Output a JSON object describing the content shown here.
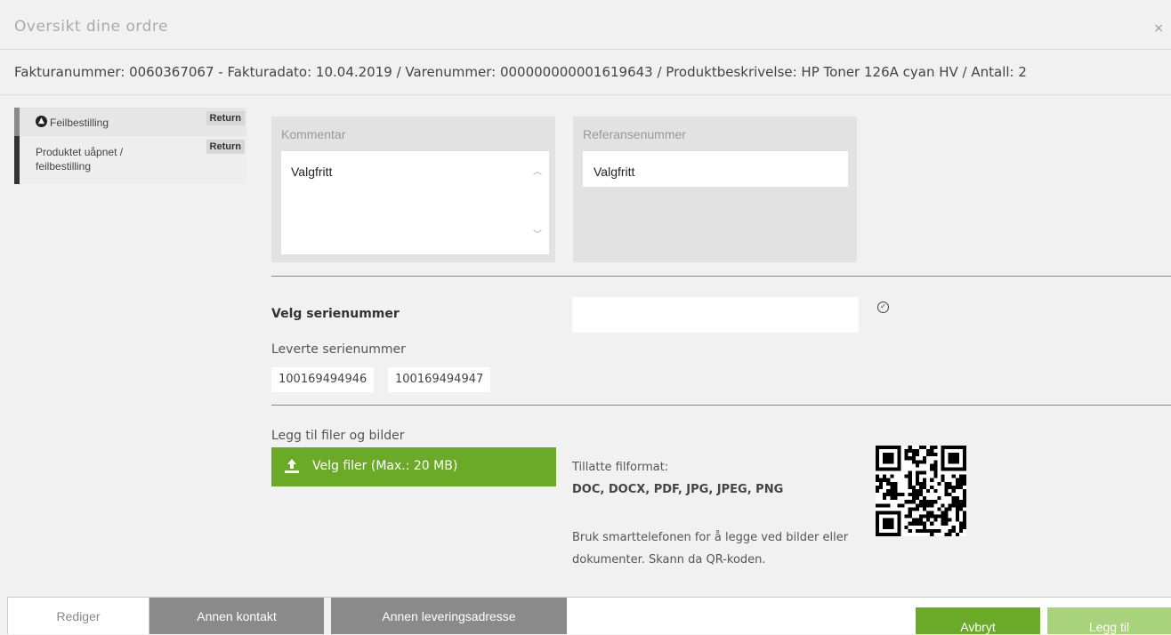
{
  "dialog": {
    "title": "Oversikt dine ordre",
    "close_symbol": "×"
  },
  "order_info": "Fakturanummer: 0060367067 - Fakturadato: 10.04.2019 / Varenummer: 000000000001619643 / Produktbeskrivelse: HP Toner 126A cyan HV / Antall: 2",
  "reasons": [
    {
      "label": "Feilbestilling",
      "badge": "Return",
      "icon": "arrow-up-circle-icon"
    },
    {
      "label": "Produktet uåpnet / feilbestilling",
      "badge": "Return"
    }
  ],
  "comment": {
    "label": "Kommentar",
    "value": "Valgfritt"
  },
  "reference": {
    "label": "Referansenummer",
    "value": "Valgfritt"
  },
  "serial": {
    "label": "Velg serienummer",
    "input_value": "",
    "delivered_label": "Leverte serienummer",
    "delivered": [
      "100169494946",
      "100169494947"
    ]
  },
  "files": {
    "label": "Legg til filer og bilder",
    "button_label": "Velg filer (Max.: 20 MB)",
    "formats_label": "Tillatte filformat:",
    "formats": "DOC, DOCX, PDF, JPG, JPEG, PNG",
    "phone_hint": "Bruk smarttelefonen for å legge ved bilder eller dokumenter. Skann da QR-koden."
  },
  "footer": {
    "tabs": [
      "Rediger",
      "Annen kontakt",
      "Annen leveringsadresse"
    ],
    "cancel_label": "Avbryt",
    "add_label": "Legg til"
  },
  "colors": {
    "accent_green": "#6aaa26",
    "accent_green_light": "#a8d27c",
    "tab_gray": "#8a8a8a"
  }
}
